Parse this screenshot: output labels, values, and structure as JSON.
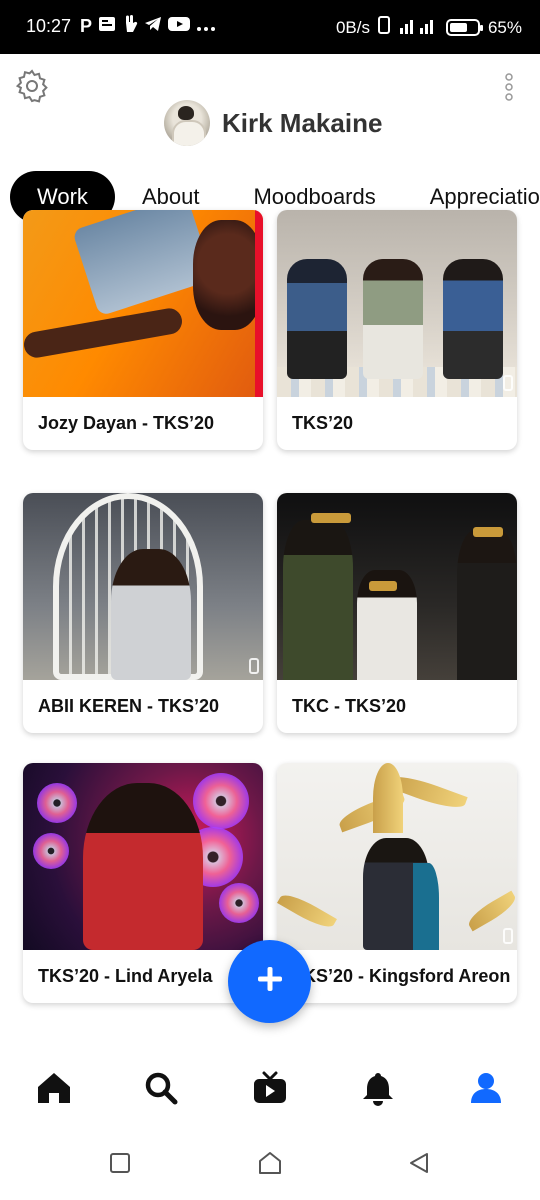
{
  "status_bar": {
    "time": "10:27",
    "left_icons": [
      "p-icon",
      "news-icon",
      "hand-icon",
      "telegram-icon",
      "youtube-icon",
      "more-dots-icon"
    ],
    "net_speed": "0B/s",
    "battery": "65%",
    "battery_level": 0.65
  },
  "header": {
    "profile_name": "Kirk Makaine"
  },
  "tabs": [
    {
      "label": "Work",
      "active": true
    },
    {
      "label": "About",
      "active": false
    },
    {
      "label": "Moodboards",
      "active": false
    },
    {
      "label": "Appreciations",
      "active": false
    }
  ],
  "projects": [
    {
      "title": "Jozy Dayan - TKS’20"
    },
    {
      "title": "TKS’20"
    },
    {
      "title": "ABII KEREN - TKS’20"
    },
    {
      "title": "TKC - TKS’20"
    },
    {
      "title": "TKS’20 - Lind Aryela"
    },
    {
      "title": "TKS’20 - Kingsford Areon"
    }
  ],
  "fab": {
    "icon": "plus-icon"
  },
  "bottom_nav": [
    {
      "icon": "home-icon",
      "active": false
    },
    {
      "icon": "search-icon",
      "active": false
    },
    {
      "icon": "tv-icon",
      "active": false
    },
    {
      "icon": "bell-icon",
      "active": false
    },
    {
      "icon": "profile-icon",
      "active": true
    }
  ],
  "colors": {
    "accent": "#1169ff",
    "tab_active_bg": "#000000",
    "text_primary": "#111111"
  }
}
